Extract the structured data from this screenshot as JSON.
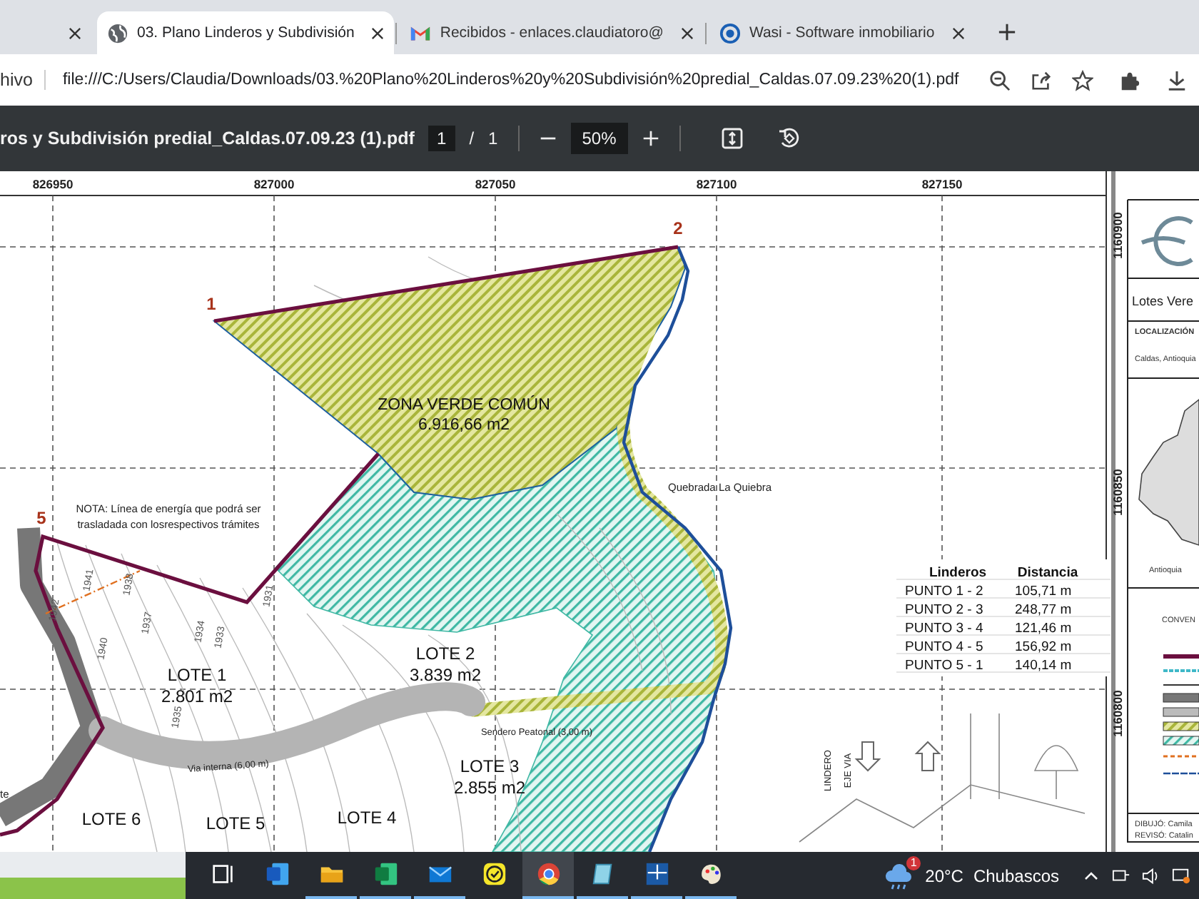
{
  "tabs": [
    {
      "kind": "partial",
      "selected": false
    },
    {
      "kind": "globe",
      "title": "03. Plano Linderos y Subdivisión",
      "selected": true
    },
    {
      "kind": "gmail",
      "title": "Recibidos - enlaces.claudiatoro@",
      "selected": false
    },
    {
      "kind": "wasi",
      "title": "Wasi - Software inmobiliario",
      "selected": false
    }
  ],
  "address_bar": {
    "menu_fragment": "hivo",
    "url": "file:///C:/Users/Claudia/Downloads/03.%20Plano%20Linderos%20y%20Subdivisión%20predial_Caldas.07.09.23%20(1).pdf"
  },
  "pdf_toolbar": {
    "title": "ros y Subdivisión predial_Caldas.07.09.23 (1).pdf",
    "page": "1",
    "page_separator": "/",
    "page_count": "1",
    "zoom": "50%"
  },
  "map": {
    "x_coords": [
      "826950",
      "827000",
      "827050",
      "827100",
      "827150"
    ],
    "y_coords": [
      "1160900",
      "1160850",
      "1160800"
    ],
    "points": [
      "1",
      "2",
      "5"
    ],
    "zone": {
      "name": "ZONA VERDE COMÚN",
      "area": "6.916,66 m2"
    },
    "note": [
      "NOTA: Línea de energía que podrá ser",
      "trasladada con losrespectivos trámites"
    ],
    "creek": "Quebrada La Quiebra",
    "lots": [
      {
        "name": "LOTE 1",
        "area": "2.801 m2"
      },
      {
        "name": "LOTE 2",
        "area": "3.839 m2"
      },
      {
        "name": "LOTE 3",
        "area": "2.855 m2"
      },
      {
        "name": "LOTE 6"
      },
      {
        "name": "LOTE 5"
      },
      {
        "name": "LOTE 4"
      }
    ],
    "roads": [
      "Via interna (6,00 m)",
      "Sendero Peatonal (3,00 m)"
    ],
    "edge_text": "te",
    "contours": [
      "1941",
      "1938",
      "1942",
      "1937",
      "1934",
      "1933",
      "1940",
      "1935",
      "1931"
    ],
    "section_labels": [
      "LINDERO",
      "EJE VIA"
    ]
  },
  "linderos_table": {
    "columns": [
      "Linderos",
      "Distancia"
    ],
    "rows": [
      [
        "PUNTO 1 - 2",
        "105,71 m"
      ],
      [
        "PUNTO 2 - 3",
        "248,77 m"
      ],
      [
        "PUNTO 3 - 4",
        "121,46 m"
      ],
      [
        "PUNTO 4 - 5",
        "156,92 m"
      ],
      [
        "PUNTO 5 - 1",
        "140,14 m"
      ]
    ]
  },
  "title_block": {
    "project": "Lotes Vere",
    "location_heading": "LOCALIZACIÓN",
    "location": "Caldas, Antioquia",
    "map_label": "Antioquia",
    "legend_heading": "CONVEN",
    "drawn_by": "DIBUJÓ: Camila",
    "reviewed_by": "REVISÓ: Catalin"
  },
  "taskbar": {
    "apps": [
      {
        "kind": "taskview",
        "running": false,
        "selected": false
      },
      {
        "kind": "word",
        "running": false,
        "selected": false
      },
      {
        "kind": "folder",
        "running": true,
        "selected": false
      },
      {
        "kind": "excel",
        "running": true,
        "selected": false
      },
      {
        "kind": "mail",
        "running": true,
        "selected": false
      },
      {
        "kind": "check",
        "running": false,
        "selected": false
      },
      {
        "kind": "chrome",
        "running": true,
        "selected": true
      },
      {
        "kind": "notepad",
        "running": true,
        "selected": false
      },
      {
        "kind": "linuxnet",
        "running": true,
        "selected": false
      },
      {
        "kind": "paint",
        "running": true,
        "selected": false
      }
    ],
    "weather": {
      "badge": "1",
      "temperature": "20°C",
      "condition": "Chubascos"
    }
  }
}
